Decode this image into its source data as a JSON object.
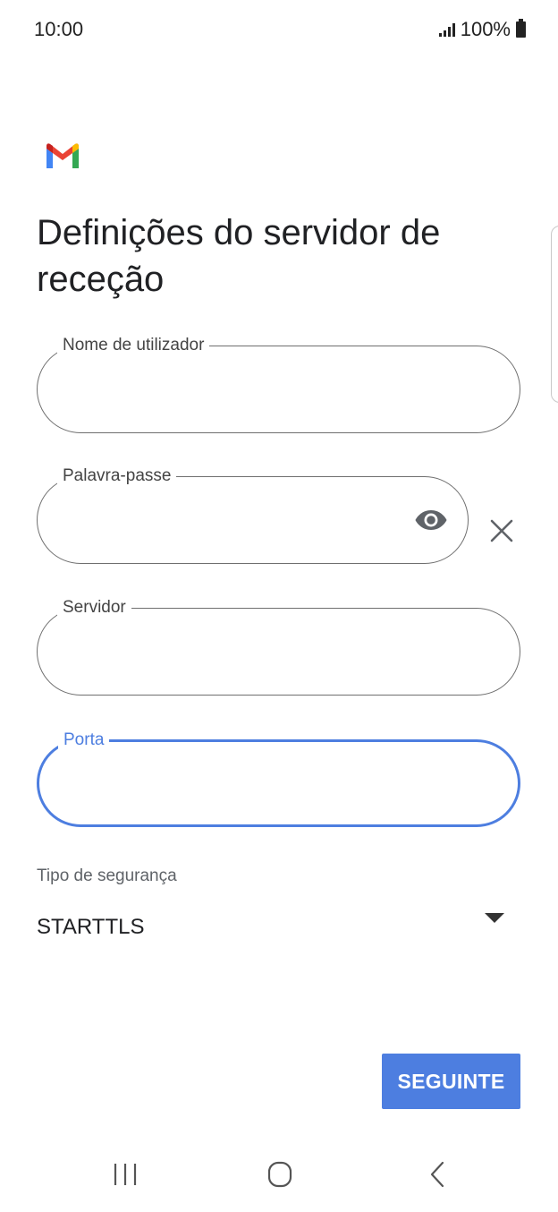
{
  "status_bar": {
    "time": "10:00",
    "battery": "100%"
  },
  "title": "Definições do servidor de receção",
  "fields": {
    "username": {
      "label": "Nome de utilizador",
      "value": ""
    },
    "password": {
      "label": "Palavra-passe",
      "value": ""
    },
    "server": {
      "label": "Servidor",
      "value": ""
    },
    "port": {
      "label": "Porta",
      "value": ""
    }
  },
  "security": {
    "label": "Tipo de segurança",
    "selected": "STARTTLS"
  },
  "next_button": {
    "label": "SEGUINTE"
  },
  "colors": {
    "accent": "#4d7ee0",
    "outline": "#6f6f6f"
  },
  "icons": {
    "logo": "gmail-logo",
    "password_toggle": "eye-icon",
    "clear": "close-icon",
    "dropdown": "dropdown-arrow-icon",
    "nav": [
      "recents-icon",
      "home-icon",
      "back-icon"
    ]
  }
}
